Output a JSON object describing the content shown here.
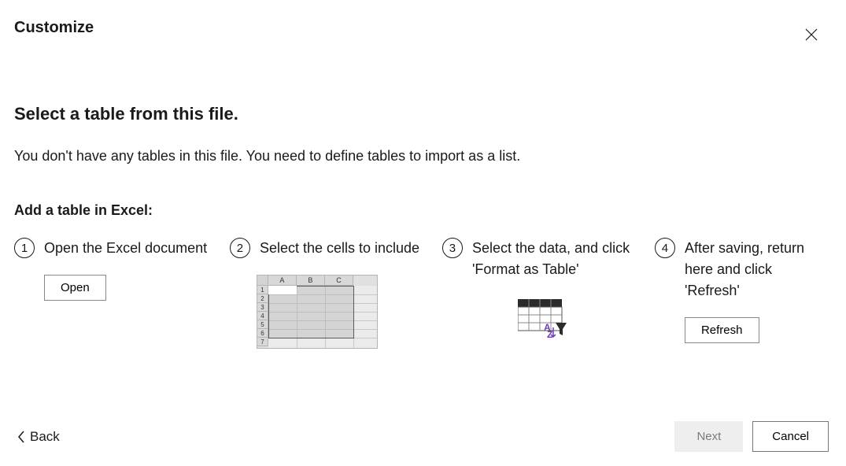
{
  "header": {
    "title": "Customize"
  },
  "main": {
    "section_title": "Select a table from this file.",
    "instructions": "You don't have any tables in this file. You need to define tables to import as a list.",
    "subsection_title": "Add a table in Excel:",
    "steps": [
      {
        "num": "1",
        "text": "Open the Excel document",
        "action_label": "Open"
      },
      {
        "num": "2",
        "text": "Select the cells to include"
      },
      {
        "num": "3",
        "text": "Select the data, and click 'Format as Table'"
      },
      {
        "num": "4",
        "text": "After saving, return here and click 'Refresh'",
        "action_label": "Refresh"
      }
    ],
    "spreadsheet_columns": [
      "A",
      "B",
      "C"
    ],
    "spreadsheet_rows": [
      "1",
      "2",
      "3",
      "4",
      "5",
      "6",
      "7"
    ]
  },
  "footer": {
    "back_label": "Back",
    "next_label": "Next",
    "cancel_label": "Cancel"
  }
}
